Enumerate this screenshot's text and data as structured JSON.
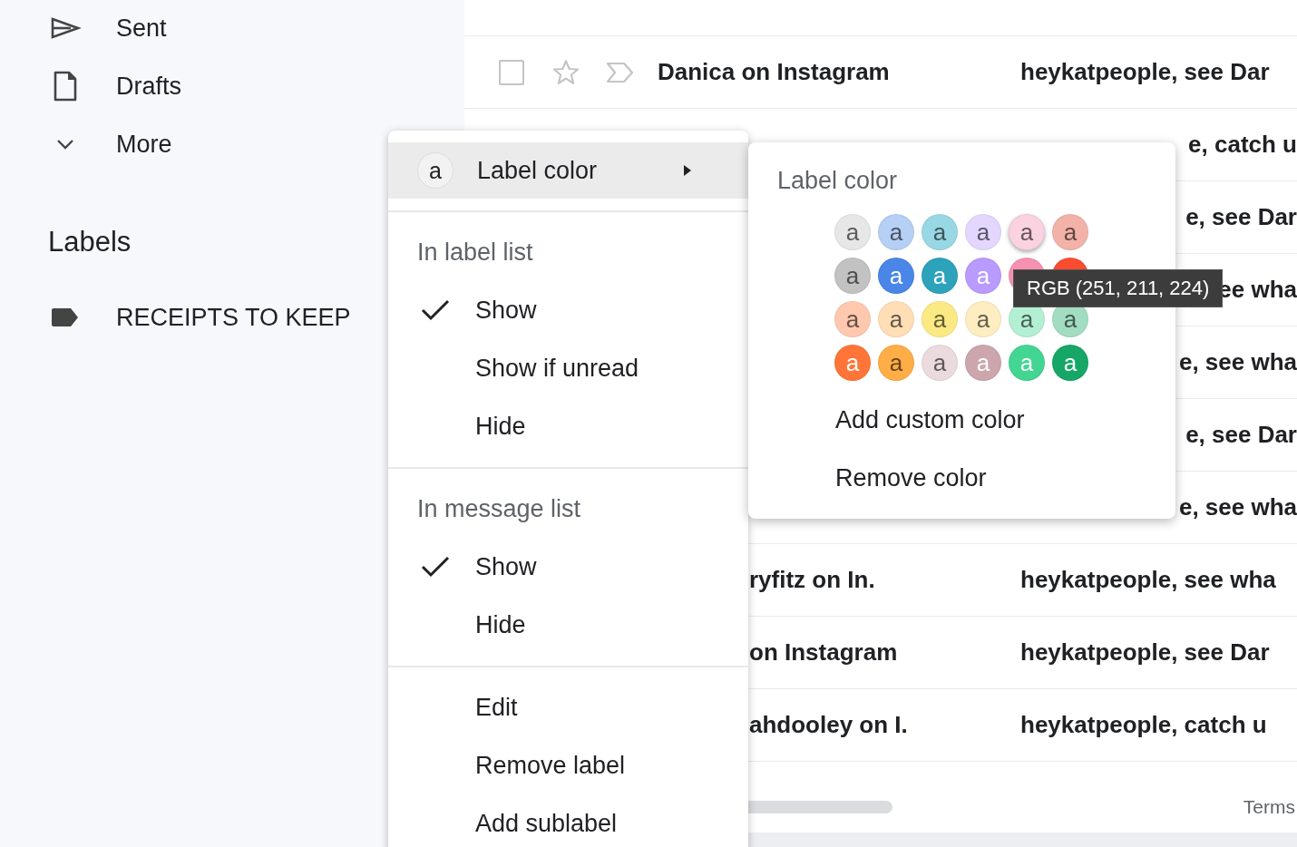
{
  "sidebar": {
    "items": [
      {
        "kind": "sent",
        "label": "Sent"
      },
      {
        "kind": "drafts",
        "label": "Drafts"
      },
      {
        "kind": "more",
        "label": "More"
      }
    ]
  },
  "labels": {
    "title": "Labels",
    "items": [
      {
        "name": "RECEIPTS TO KEEP"
      }
    ]
  },
  "messages": [
    {
      "kind": "full",
      "checked": false,
      "starred": false,
      "sender": "Danica on Instagram",
      "snippet": "heykatpeople, see Dar"
    },
    {
      "kind": "snippet_part",
      "snippet": "e, catch u"
    },
    {
      "kind": "snippet_part",
      "snippet": "e, see Dar"
    },
    {
      "kind": "snippet_part",
      "snippet": "ee wha"
    },
    {
      "kind": "snippet_part",
      "snippet": "e, see wha"
    },
    {
      "kind": "snippet_part",
      "snippet": "e, see Dar"
    },
    {
      "kind": "snippet_part",
      "snippet": "e, see wha"
    },
    {
      "kind": "sender_part",
      "sender": "ryfitz on In.",
      "snippet": "heykatpeople, see wha"
    },
    {
      "kind": "sender_part",
      "sender": "on Instagram",
      "snippet": "heykatpeople, see Dar"
    },
    {
      "kind": "sender_part",
      "sender": "ahdooley on I.",
      "snippet": "heykatpeople, catch u"
    }
  ],
  "footer": {
    "link": "Terms"
  },
  "context_menu": {
    "items": [
      {
        "kind": "submenu",
        "label": "Label color",
        "swatch_text": "a",
        "highlighted": true
      },
      {
        "kind": "divider"
      },
      {
        "kind": "header",
        "label": "In label list"
      },
      {
        "kind": "option",
        "label": "Show",
        "checked": true,
        "highlighted": false
      },
      {
        "kind": "option",
        "label": "Show if unread",
        "checked": false,
        "highlighted": false
      },
      {
        "kind": "option",
        "label": "Hide",
        "checked": false,
        "highlighted": false
      },
      {
        "kind": "divider"
      },
      {
        "kind": "header",
        "label": "In message list"
      },
      {
        "kind": "option",
        "label": "Show",
        "checked": true,
        "highlighted": false
      },
      {
        "kind": "option",
        "label": "Hide",
        "checked": false,
        "highlighted": false
      },
      {
        "kind": "divider"
      },
      {
        "kind": "option",
        "label": "Edit",
        "checked": false,
        "highlighted": false
      },
      {
        "kind": "option",
        "label": "Remove label",
        "checked": false,
        "highlighted": false
      },
      {
        "kind": "option",
        "label": "Add sublabel",
        "checked": false,
        "highlighted": false
      }
    ]
  },
  "color_menu": {
    "title": "Label color",
    "swatches": [
      {
        "text": "a",
        "color": "#e7e7e7",
        "hovered": false
      },
      {
        "text": "a",
        "color": "#b6cff5",
        "hovered": false
      },
      {
        "text": "a",
        "color": "#98d7e4",
        "hovered": false
      },
      {
        "text": "a",
        "color": "#e3d7ff",
        "hovered": false
      },
      {
        "text": "a",
        "color": "#fbd3e0",
        "hovered": true
      },
      {
        "text": "a",
        "color": "#f2b2a8",
        "hovered": false
      },
      {
        "text": "a",
        "color": "#c2c2c2",
        "hovered": false
      },
      {
        "text": "a",
        "color": "#4986e7",
        "hovered": false
      },
      {
        "text": "a",
        "color": "#2da2bb",
        "hovered": false
      },
      {
        "text": "a",
        "color": "#b99aff",
        "hovered": false
      },
      {
        "color": "#f691b2",
        "hovered": false
      },
      {
        "color": "#fb4c2f",
        "hovered": false
      },
      {
        "text": "a",
        "color": "#ffc8af",
        "hovered": false
      },
      {
        "text": "a",
        "color": "#ffdeb5",
        "hovered": false
      },
      {
        "text": "a",
        "color": "#fbe983",
        "hovered": false
      },
      {
        "text": "a",
        "color": "#fdedc1",
        "hovered": false
      },
      {
        "text": "a",
        "color": "#b3efd3",
        "hovered": false
      },
      {
        "text": "a",
        "color": "#a2dcc1",
        "hovered": false
      },
      {
        "text": "a",
        "color": "#ff7537",
        "hovered": false
      },
      {
        "text": "a",
        "color": "#ffad46",
        "hovered": false
      },
      {
        "text": "a",
        "color": "#ebdbde",
        "hovered": false
      },
      {
        "text": "a",
        "color": "#cca6ac",
        "hovered": false
      },
      {
        "text": "a",
        "color": "#42d692",
        "hovered": false
      },
      {
        "text": "a",
        "color": "#16a766",
        "hovered": false
      }
    ],
    "actions": [
      "Add custom color",
      "Remove color"
    ]
  },
  "tooltip": {
    "text": "RGB (251, 211, 224)"
  }
}
